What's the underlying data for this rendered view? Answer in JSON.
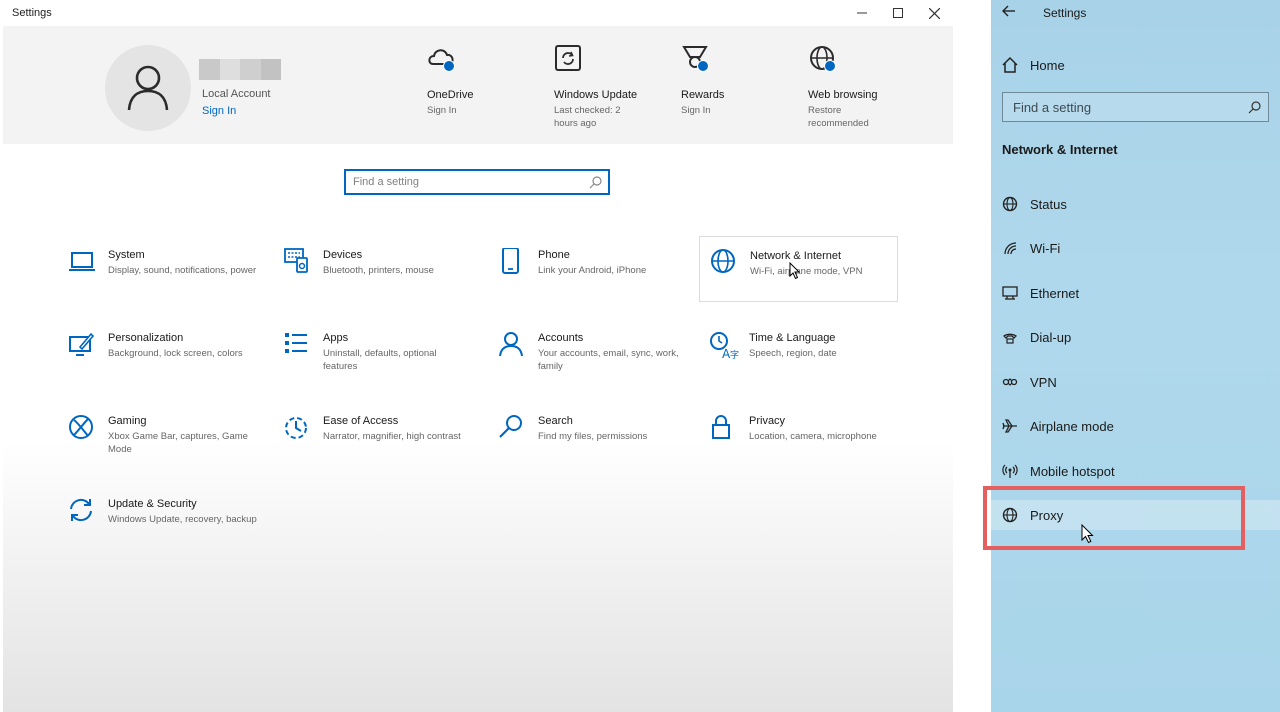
{
  "window": {
    "title": "Settings",
    "controls": {
      "minimize": "minimize",
      "maximize": "maximize",
      "close": "close"
    }
  },
  "account": {
    "type": "Local Account",
    "sign_in": "Sign In"
  },
  "header_items": [
    {
      "title": "OneDrive",
      "subtitle": "Sign In",
      "icon": "cloud-icon"
    },
    {
      "title": "Windows Update",
      "subtitle": "Last checked: 2 hours ago",
      "icon": "sync-icon"
    },
    {
      "title": "Rewards",
      "subtitle": "Sign In",
      "icon": "trophy-icon"
    },
    {
      "title": "Web browsing",
      "subtitle": "Restore recommended",
      "icon": "globe-icon"
    }
  ],
  "search": {
    "placeholder": "Find a setting"
  },
  "categories": [
    {
      "title": "System",
      "subtitle": "Display, sound, notifications, power",
      "icon": "laptop-icon"
    },
    {
      "title": "Devices",
      "subtitle": "Bluetooth, printers, mouse",
      "icon": "keyboard-icon"
    },
    {
      "title": "Phone",
      "subtitle": "Link your Android, iPhone",
      "icon": "phone-icon"
    },
    {
      "title": "Network & Internet",
      "subtitle": "Wi-Fi, airplane mode, VPN",
      "icon": "globe-icon"
    },
    {
      "title": "Personalization",
      "subtitle": "Background, lock screen, colors",
      "icon": "paint-icon"
    },
    {
      "title": "Apps",
      "subtitle": "Uninstall, defaults, optional features",
      "icon": "apps-list-icon"
    },
    {
      "title": "Accounts",
      "subtitle": "Your accounts, email, sync, work, family",
      "icon": "person-icon"
    },
    {
      "title": "Time & Language",
      "subtitle": "Speech, region, date",
      "icon": "time-language-icon"
    },
    {
      "title": "Gaming",
      "subtitle": "Xbox Game Bar, captures, Game Mode",
      "icon": "xbox-icon"
    },
    {
      "title": "Ease of Access",
      "subtitle": "Narrator, magnifier, high contrast",
      "icon": "ease-of-access-icon"
    },
    {
      "title": "Search",
      "subtitle": "Find my files, permissions",
      "icon": "search-icon"
    },
    {
      "title": "Privacy",
      "subtitle": "Location, camera, microphone",
      "icon": "lock-icon"
    },
    {
      "title": "Update & Security",
      "subtitle": "Windows Update, recovery, backup",
      "icon": "sync-icon"
    }
  ],
  "side_panel": {
    "title": "Settings",
    "home": "Home",
    "search_placeholder": "Find a setting",
    "section": "Network & Internet",
    "items": [
      {
        "label": "Status",
        "icon": "globe-icon"
      },
      {
        "label": "Wi-Fi",
        "icon": "wifi-icon"
      },
      {
        "label": "Ethernet",
        "icon": "ethernet-icon"
      },
      {
        "label": "Dial-up",
        "icon": "dialup-icon"
      },
      {
        "label": "VPN",
        "icon": "vpn-icon"
      },
      {
        "label": "Airplane mode",
        "icon": "airplane-icon"
      },
      {
        "label": "Mobile hotspot",
        "icon": "hotspot-icon"
      },
      {
        "label": "Proxy",
        "icon": "globe-icon"
      }
    ],
    "selected": "Proxy"
  },
  "colors": {
    "accent": "#0067c0",
    "highlight_box": "#e45f5f",
    "panel_bg": "#acd4e9"
  }
}
